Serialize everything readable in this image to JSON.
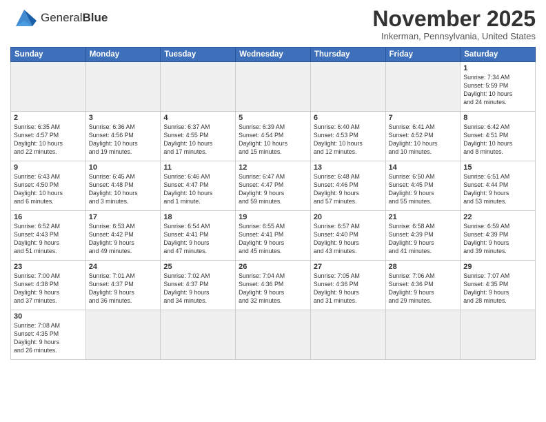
{
  "header": {
    "logo_text_normal": "General",
    "logo_text_bold": "Blue",
    "month_title": "November 2025",
    "subtitle": "Inkerman, Pennsylvania, United States"
  },
  "calendar": {
    "days_of_week": [
      "Sunday",
      "Monday",
      "Tuesday",
      "Wednesday",
      "Thursday",
      "Friday",
      "Saturday"
    ],
    "weeks": [
      [
        {
          "day": "",
          "empty": true
        },
        {
          "day": "",
          "empty": true
        },
        {
          "day": "",
          "empty": true
        },
        {
          "day": "",
          "empty": true
        },
        {
          "day": "",
          "empty": true
        },
        {
          "day": "",
          "empty": true
        },
        {
          "day": "1",
          "info": "Sunrise: 7:34 AM\nSunset: 5:59 PM\nDaylight: 10 hours\nand 24 minutes."
        }
      ],
      [
        {
          "day": "2",
          "info": "Sunrise: 6:35 AM\nSunset: 4:57 PM\nDaylight: 10 hours\nand 22 minutes."
        },
        {
          "day": "3",
          "info": "Sunrise: 6:36 AM\nSunset: 4:56 PM\nDaylight: 10 hours\nand 19 minutes."
        },
        {
          "day": "4",
          "info": "Sunrise: 6:37 AM\nSunset: 4:55 PM\nDaylight: 10 hours\nand 17 minutes."
        },
        {
          "day": "5",
          "info": "Sunrise: 6:39 AM\nSunset: 4:54 PM\nDaylight: 10 hours\nand 15 minutes."
        },
        {
          "day": "6",
          "info": "Sunrise: 6:40 AM\nSunset: 4:53 PM\nDaylight: 10 hours\nand 12 minutes."
        },
        {
          "day": "7",
          "info": "Sunrise: 6:41 AM\nSunset: 4:52 PM\nDaylight: 10 hours\nand 10 minutes."
        },
        {
          "day": "8",
          "info": "Sunrise: 6:42 AM\nSunset: 4:51 PM\nDaylight: 10 hours\nand 8 minutes."
        }
      ],
      [
        {
          "day": "9",
          "info": "Sunrise: 6:43 AM\nSunset: 4:50 PM\nDaylight: 10 hours\nand 6 minutes."
        },
        {
          "day": "10",
          "info": "Sunrise: 6:45 AM\nSunset: 4:48 PM\nDaylight: 10 hours\nand 3 minutes."
        },
        {
          "day": "11",
          "info": "Sunrise: 6:46 AM\nSunset: 4:47 PM\nDaylight: 10 hours\nand 1 minute."
        },
        {
          "day": "12",
          "info": "Sunrise: 6:47 AM\nSunset: 4:47 PM\nDaylight: 9 hours\nand 59 minutes."
        },
        {
          "day": "13",
          "info": "Sunrise: 6:48 AM\nSunset: 4:46 PM\nDaylight: 9 hours\nand 57 minutes."
        },
        {
          "day": "14",
          "info": "Sunrise: 6:50 AM\nSunset: 4:45 PM\nDaylight: 9 hours\nand 55 minutes."
        },
        {
          "day": "15",
          "info": "Sunrise: 6:51 AM\nSunset: 4:44 PM\nDaylight: 9 hours\nand 53 minutes."
        }
      ],
      [
        {
          "day": "16",
          "info": "Sunrise: 6:52 AM\nSunset: 4:43 PM\nDaylight: 9 hours\nand 51 minutes."
        },
        {
          "day": "17",
          "info": "Sunrise: 6:53 AM\nSunset: 4:42 PM\nDaylight: 9 hours\nand 49 minutes."
        },
        {
          "day": "18",
          "info": "Sunrise: 6:54 AM\nSunset: 4:41 PM\nDaylight: 9 hours\nand 47 minutes."
        },
        {
          "day": "19",
          "info": "Sunrise: 6:55 AM\nSunset: 4:41 PM\nDaylight: 9 hours\nand 45 minutes."
        },
        {
          "day": "20",
          "info": "Sunrise: 6:57 AM\nSunset: 4:40 PM\nDaylight: 9 hours\nand 43 minutes."
        },
        {
          "day": "21",
          "info": "Sunrise: 6:58 AM\nSunset: 4:39 PM\nDaylight: 9 hours\nand 41 minutes."
        },
        {
          "day": "22",
          "info": "Sunrise: 6:59 AM\nSunset: 4:39 PM\nDaylight: 9 hours\nand 39 minutes."
        }
      ],
      [
        {
          "day": "23",
          "info": "Sunrise: 7:00 AM\nSunset: 4:38 PM\nDaylight: 9 hours\nand 37 minutes."
        },
        {
          "day": "24",
          "info": "Sunrise: 7:01 AM\nSunset: 4:37 PM\nDaylight: 9 hours\nand 36 minutes."
        },
        {
          "day": "25",
          "info": "Sunrise: 7:02 AM\nSunset: 4:37 PM\nDaylight: 9 hours\nand 34 minutes."
        },
        {
          "day": "26",
          "info": "Sunrise: 7:04 AM\nSunset: 4:36 PM\nDaylight: 9 hours\nand 32 minutes."
        },
        {
          "day": "27",
          "info": "Sunrise: 7:05 AM\nSunset: 4:36 PM\nDaylight: 9 hours\nand 31 minutes."
        },
        {
          "day": "28",
          "info": "Sunrise: 7:06 AM\nSunset: 4:36 PM\nDaylight: 9 hours\nand 29 minutes."
        },
        {
          "day": "29",
          "info": "Sunrise: 7:07 AM\nSunset: 4:35 PM\nDaylight: 9 hours\nand 28 minutes."
        }
      ],
      [
        {
          "day": "30",
          "info": "Sunrise: 7:08 AM\nSunset: 4:35 PM\nDaylight: 9 hours\nand 26 minutes."
        },
        {
          "day": "",
          "empty": true
        },
        {
          "day": "",
          "empty": true
        },
        {
          "day": "",
          "empty": true
        },
        {
          "day": "",
          "empty": true
        },
        {
          "day": "",
          "empty": true
        },
        {
          "day": "",
          "empty": true
        }
      ]
    ]
  }
}
